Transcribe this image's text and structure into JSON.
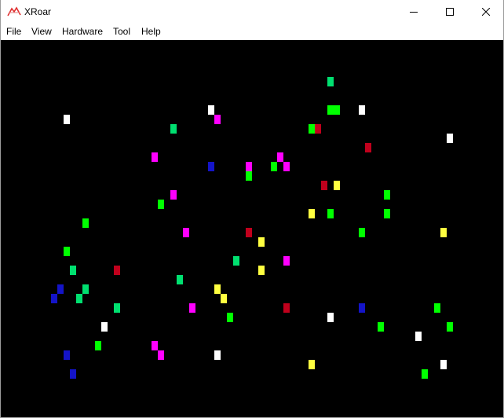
{
  "window": {
    "title": "XRoar"
  },
  "menu": [
    "File",
    "View",
    "Hardware",
    "Tool",
    "Help"
  ],
  "colors": {
    "screen_bg": "#000000",
    "green": "#00ff00",
    "teal": "#00e070",
    "white": "#ffffff",
    "magenta": "#ff00ff",
    "red": "#c0001c",
    "blue": "#1414c8",
    "yellow": "#ffff40"
  },
  "icons": {
    "app": "xroar-app-icon",
    "minimize": "minimize-icon",
    "maximize": "maximize-icon",
    "close": "close-icon"
  }
}
